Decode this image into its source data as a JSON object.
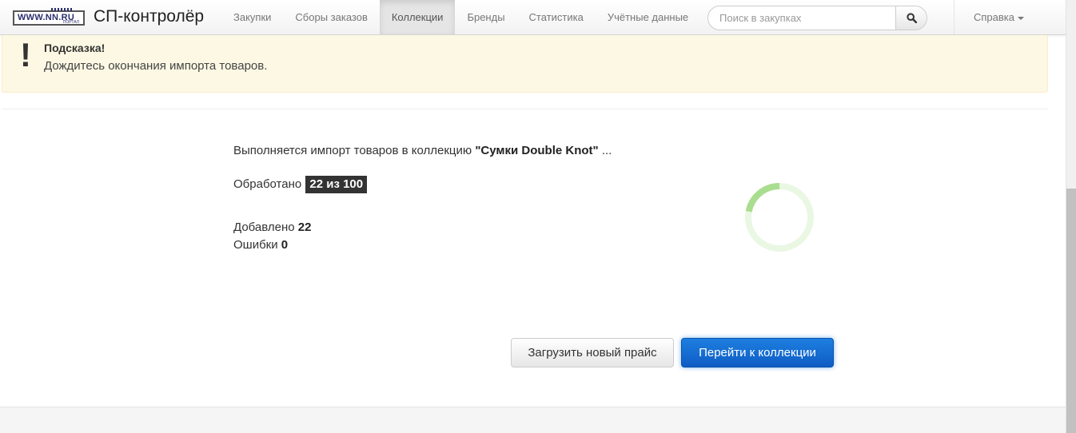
{
  "navbar": {
    "logo_text": "WWW.NN.RU",
    "logo_sub": "ПОРТАЛ",
    "brand": "СП-контролёр",
    "items": [
      {
        "label": "Закупки"
      },
      {
        "label": "Сборы заказов"
      },
      {
        "label": "Коллекции",
        "active": true
      },
      {
        "label": "Бренды"
      },
      {
        "label": "Статистика"
      },
      {
        "label": "Учётные данные"
      }
    ],
    "search_placeholder": "Поиск в закупках",
    "search_icon": "search-icon",
    "help_label": "Справка"
  },
  "alert": {
    "mark": "!",
    "title": "Подсказка!",
    "text": "Дождитесь окончания импорта товаров."
  },
  "import": {
    "status_prefix": "Выполняется импорт товаров в коллекцию",
    "collection_name": "\"Сумки Double Knot\"",
    "status_suffix": "...",
    "processed_label": "Обработано",
    "processed_badge": "22 из 100",
    "added_label": "Добавлено",
    "added_value": "22",
    "errors_label": "Ошибки",
    "errors_value": "0",
    "spinner_arc_fraction": 0.22
  },
  "buttons": {
    "upload_new_price": "Загрузить новый прайс",
    "go_to_collection": "Перейти к коллекции"
  },
  "colors": {
    "alert_bg": "#fcf8e3",
    "badge_bg": "#333333",
    "primary": "#0e5cc4",
    "spinner_arc": "#a9dd8f",
    "spinner_track": "#eaf7e3"
  }
}
